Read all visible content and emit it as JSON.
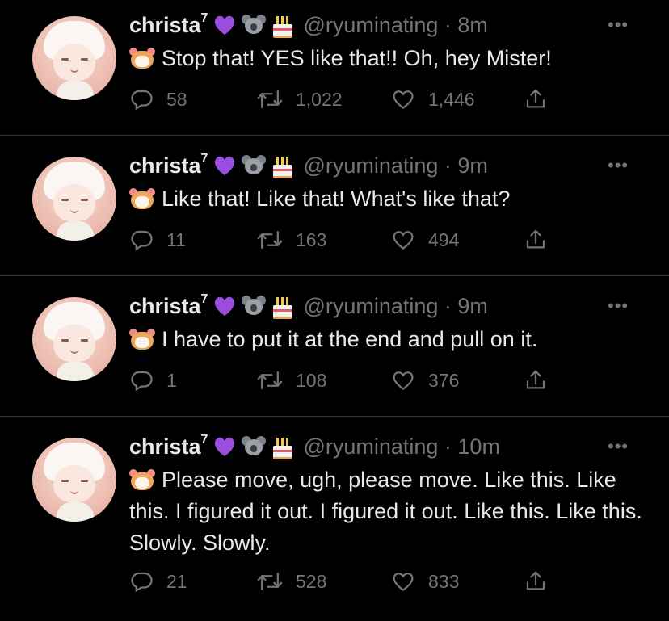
{
  "theme": {
    "background": "#000000",
    "text": "#e7e9ea",
    "secondary": "#71767b",
    "divider": "#2f3336",
    "heart_emoji": "#9b4dde"
  },
  "author": {
    "display_name": "christa",
    "superscript": "7",
    "emojis": [
      "purple-heart-emoji",
      "koala-emoji",
      "birthday-cake-emoji"
    ],
    "more_label": "•••"
  },
  "tweets": [
    {
      "handle_time": "@ryuminating · 8m",
      "text": "Stop that! YES like that!! Oh, hey Mister!",
      "replies": "58",
      "retweets": "1,022",
      "likes": "1,446"
    },
    {
      "handle_time": "@ryuminating · 9m",
      "text": "Like that! Like that! What's like that?",
      "replies": "11",
      "retweets": "163",
      "likes": "494"
    },
    {
      "handle_time": "@ryuminating · 9m",
      "text": "I have to put it at the end and pull on it.",
      "replies": "1",
      "retweets": "108",
      "likes": "376"
    },
    {
      "handle_time": "@ryuminating · 10m",
      "text": "Please move, ugh, please move. Like this. Like this. I figured it out. I figured it out. Like this. Like this. Slowly. Slowly.",
      "replies": "21",
      "retweets": "528",
      "likes": "833"
    }
  ]
}
